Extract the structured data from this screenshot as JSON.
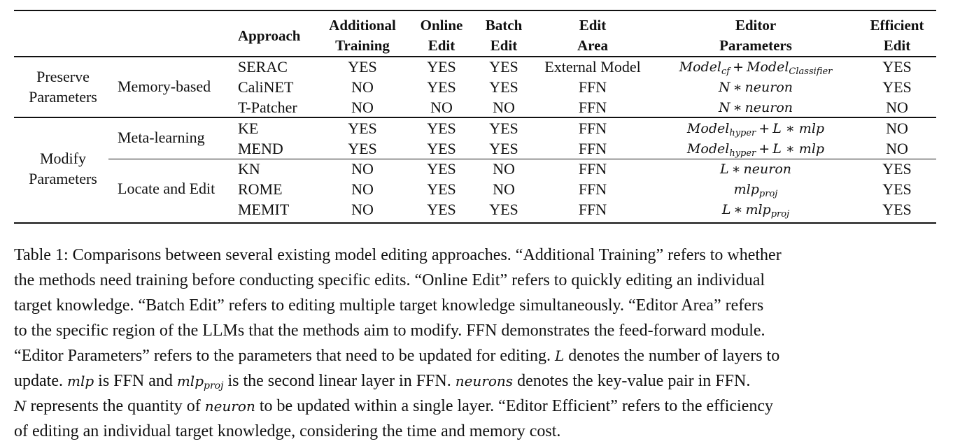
{
  "table": {
    "headers": {
      "approach": "Approach",
      "additional_training": [
        "Additional",
        "Training"
      ],
      "online_edit": [
        "Online",
        "Edit"
      ],
      "batch_edit": [
        "Batch",
        "Edit"
      ],
      "edit_area": [
        "Edit",
        "Area"
      ],
      "editor_parameters": [
        "Editor",
        "Parameters"
      ],
      "efficient_edit": [
        "Efficient",
        "Edit"
      ]
    },
    "groups": [
      {
        "label": [
          "Preserve",
          "Parameters"
        ],
        "subgroups": [
          {
            "label": "Memory-based",
            "rows": [
              {
                "approach": "SERAC",
                "additional_training": "YES",
                "online_edit": "YES",
                "batch_edit": "YES",
                "edit_area": "External Model",
                "editor_parameters": {
                  "a": "Model",
                  "a_sub": "cf",
                  "op": "+",
                  "b": "Model",
                  "b_sub": "Classifier"
                },
                "efficient_edit": "YES"
              },
              {
                "approach": "CaliNET",
                "additional_training": "NO",
                "online_edit": "YES",
                "batch_edit": "YES",
                "edit_area": "FFN",
                "editor_parameters": {
                  "a": "N",
                  "op": "∗",
                  "b": "neuron"
                },
                "efficient_edit": "YES"
              },
              {
                "approach": "T-Patcher",
                "additional_training": "NO",
                "online_edit": "NO",
                "batch_edit": "NO",
                "edit_area": "FFN",
                "editor_parameters": {
                  "a": "N",
                  "op": "∗",
                  "b": "neuron"
                },
                "efficient_edit": "NO"
              }
            ]
          }
        ]
      },
      {
        "label": [
          "Modify",
          "Parameters"
        ],
        "subgroups": [
          {
            "label": "Meta-learning",
            "rows": [
              {
                "approach": "KE",
                "additional_training": "YES",
                "online_edit": "YES",
                "batch_edit": "YES",
                "edit_area": "FFN",
                "editor_parameters": {
                  "a": "Model",
                  "a_sub": "hyper",
                  "op": "+",
                  "b": "L ∗ mlp"
                },
                "efficient_edit": "NO"
              },
              {
                "approach": "MEND",
                "additional_training": "YES",
                "online_edit": "YES",
                "batch_edit": "YES",
                "edit_area": "FFN",
                "editor_parameters": {
                  "a": "Model",
                  "a_sub": "hyper",
                  "op": "+",
                  "b": "L ∗ mlp"
                },
                "efficient_edit": "NO"
              }
            ]
          },
          {
            "label": "Locate and Edit",
            "rows": [
              {
                "approach": "KN",
                "additional_training": "NO",
                "online_edit": "YES",
                "batch_edit": "NO",
                "edit_area": "FFN",
                "editor_parameters": {
                  "a": "L",
                  "op": "∗",
                  "b": "neuron"
                },
                "efficient_edit": "YES"
              },
              {
                "approach": "ROME",
                "additional_training": "NO",
                "online_edit": "YES",
                "batch_edit": "NO",
                "edit_area": "FFN",
                "editor_parameters": {
                  "a": "mlp",
                  "a_sub": "proj"
                },
                "efficient_edit": "YES"
              },
              {
                "approach": "MEMIT",
                "additional_training": "NO",
                "online_edit": "YES",
                "batch_edit": "YES",
                "edit_area": "FFN",
                "editor_parameters": {
                  "a": "L",
                  "op": "∗",
                  "b": "mlp",
                  "b_sub": "proj"
                },
                "efficient_edit": "YES"
              }
            ]
          }
        ]
      }
    ]
  },
  "caption": {
    "lines": [
      "Table 1: Comparisons between several existing model editing approaches. “Additional Training” refers to whether",
      "the methods need training before conducting specific edits. “Online Edit” refers to quickly editing an individual",
      "target knowledge. “Batch Edit” refers to editing multiple target knowledge simultaneously. “Editor Area” refers",
      "to the specific region of the LLMs that the methods aim to modify. FFN demonstrates the feed-forward module.",
      "“Editor Parameters” refers to the parameters that need to be updated for editing. ",
      "update. ",
      " represents the quantity of ",
      "of editing an individual target knowledge, considering the time and memory cost."
    ],
    "line5_math": "L",
    "line5_tail": " denotes the number of layers to",
    "line6_math1": "mlp",
    "line6_mid": " is FFN and ",
    "line6_math2": "mlp",
    "line6_math2_sub": "proj",
    "line6_mid2": " is the second linear layer in FFN. ",
    "line6_math3": "neurons",
    "line6_tail": " denotes the key-value pair in FFN.",
    "line7_math1": "N",
    "line7_math2": "neuron",
    "line7_tail": " to be updated within a single layer. “Editor Efficient” refers to the efficiency"
  }
}
